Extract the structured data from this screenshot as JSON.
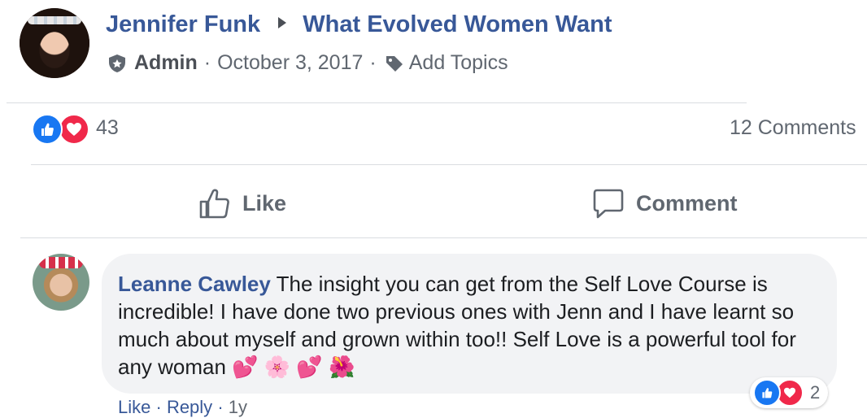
{
  "post": {
    "author": "Jennifer Funk",
    "group": "What Evolved Women Want",
    "role": "Admin",
    "date": "October 3, 2017",
    "add_topics": "Add Topics",
    "reaction_count": "43",
    "comments_count": "12 Comments",
    "icons": {
      "role": "shield-icon",
      "topics": "tag-icon",
      "separator": "triangle-right-icon"
    }
  },
  "actions": {
    "like_label": "Like",
    "comment_label": "Comment"
  },
  "comment": {
    "author": "Leanne Cawley",
    "text": "The insight you can get from the Self Love Course is incredible! I have done two previous ones with Jenn and I have learnt so much about myself and grown within too!! Self Love is a powerful tool for any woman",
    "emojis": [
      "💕",
      "🌸",
      "💕",
      "🌺"
    ],
    "reaction_count": "2",
    "action_like": "Like",
    "action_reply": "Reply",
    "time": "1y"
  },
  "colors": {
    "link": "#385898",
    "like_blue": "#1877f2",
    "love_red": "#f0284a",
    "secondary_text": "#606770",
    "bubble_bg": "#f2f3f5"
  }
}
